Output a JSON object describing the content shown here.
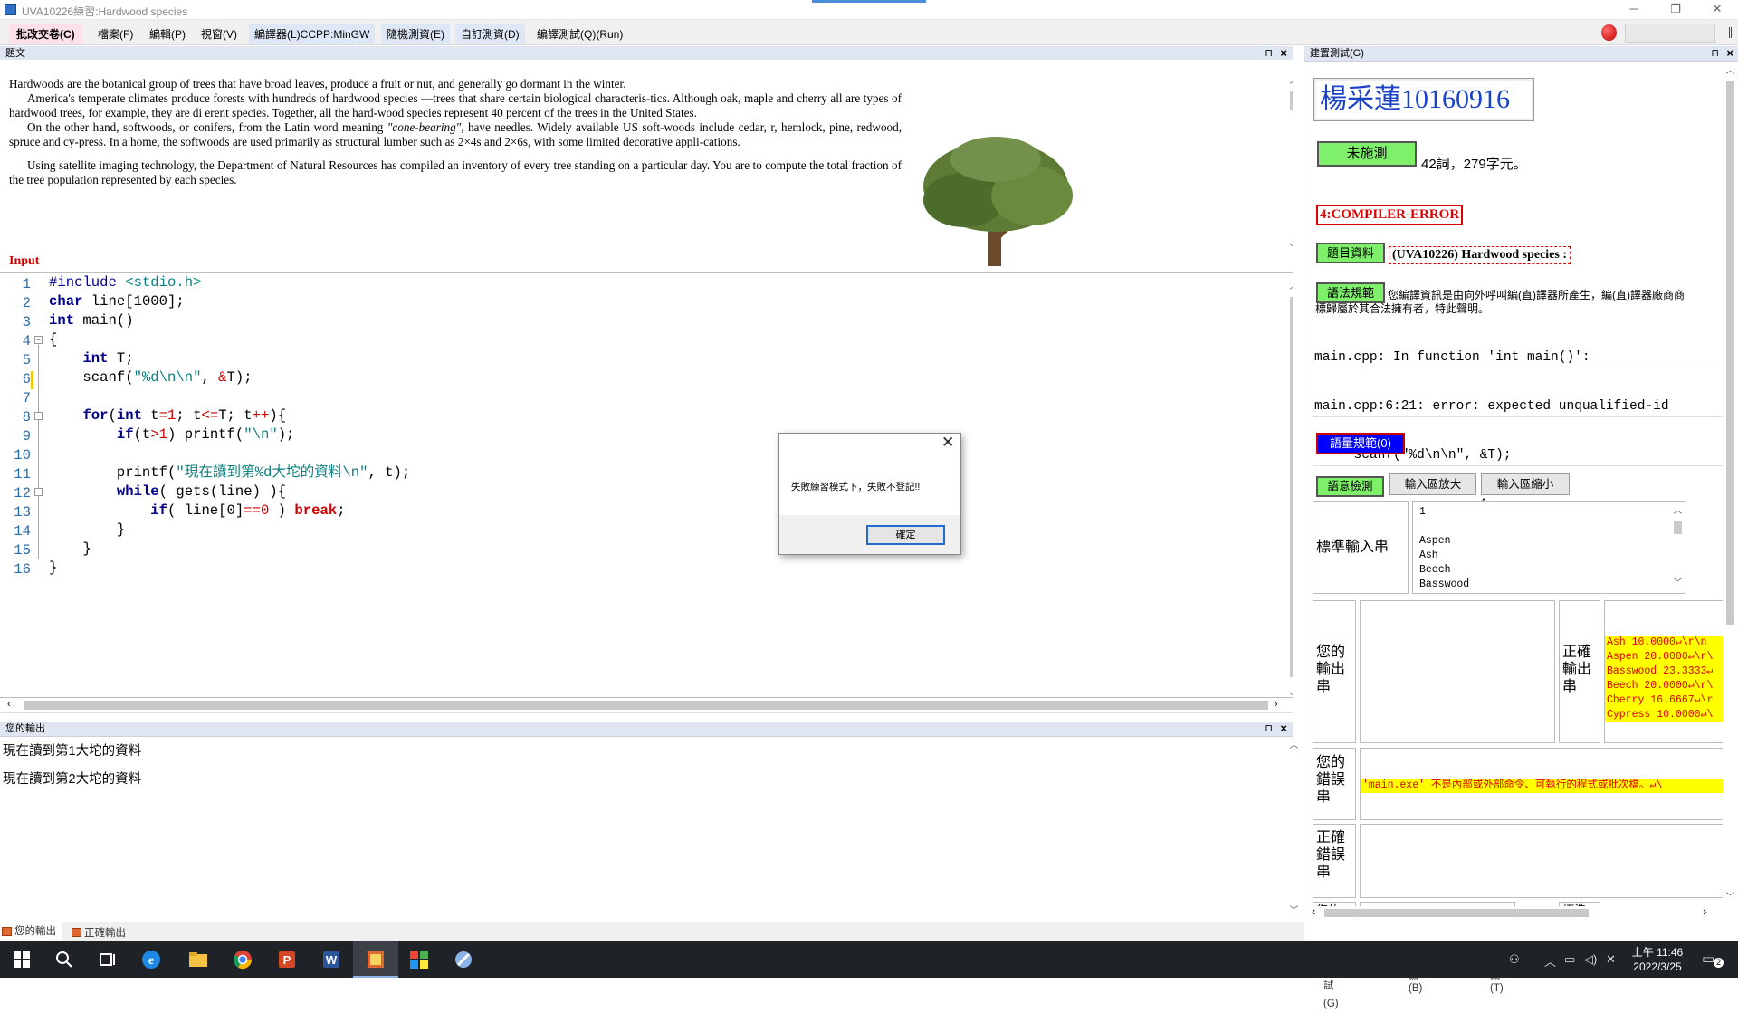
{
  "window": {
    "title": "UVA10226練習:Hardwood species",
    "minimize": "─",
    "restore": "❐",
    "close": "✕"
  },
  "menu": {
    "items": [
      "批改交卷(C)",
      "檔案(F)",
      "編輯(P)",
      "視窗(V)",
      "編譯器(L)CCPP:MinGW",
      "隨機測資(E)",
      "自訂測資(D)",
      "編譯測試(Q)(Run)"
    ]
  },
  "problem_panel": {
    "header": "題文",
    "para1": "Hardwoods are the botanical group of trees that have broad leaves, produce a fruit or nut, and generally go dormant in the winter.",
    "para2": "America's temperate climates produce forests with hundreds of hardwood species —trees that share certain biological characteris-tics. Although oak, maple and cherry all are types of hardwood trees, for example, they are di erent species. Together, all the hard-wood species represent 40 percent of the trees in the United States.",
    "para3_a": "On the other hand, softwoods, or conifers, from the Latin word meaning ",
    "para3_em": "\"cone-bearing\"",
    "para3_b": ", have needles. Widely available US soft-woods include cedar, r, hemlock, pine, redwood, spruce and cy-press. In a home, the softwoods are used primarily as structural lumber such as 2×4s and 2×6s, with some limited decorative appli-cations.",
    "para4": "Using satellite imaging technology, the Department of Natural Resources has compiled an inventory of every tree standing on a particular day. You are to compute the total fraction of the tree population represented by each species.",
    "input_heading": "Input"
  },
  "editor": {
    "line_numbers": [
      "1",
      "2",
      "3",
      "4",
      "5",
      "6",
      "7",
      "8",
      "9",
      "10",
      "11",
      "12",
      "13",
      "14",
      "15",
      "16"
    ]
  },
  "output_panel": {
    "header": "您的輸出",
    "lines": [
      "現在讀到第1大坨的資料",
      "現在讀到第2大坨的資料"
    ]
  },
  "bottom_tabs": {
    "left": [
      "您的輸出",
      "正確輸出"
    ],
    "right": [
      "建置測試(G)",
      "您的小黑(B)",
      "標準小黑(T)"
    ]
  },
  "right_panel": {
    "header": "建置測試(G)",
    "signature": "楊采蓮10160916",
    "status_button": "未施測",
    "stats": "42詞，279字元。",
    "error_label": "4:COMPILER-ERROR",
    "problem_info_button": "題目資料",
    "problem_title": "(UVA10226) Hardwood species :",
    "rules_button": "語法規範",
    "rules_note_1": "您編譯資訊是由向外呼叫編(直)譯器所產生，編(直)譯器廠商商",
    "rules_note_2": "標歸屬於其合法擁有者，特此聲明。",
    "compiler_output": [
      "main.cpp: In function 'int main()':",
      "main.cpp:6:21: error: expected unqualified-id",
      "     scanf(\"%d\\n\\n\", &T);",
      "                     ^"
    ],
    "vocab_button": "語量規範(0)",
    "check_button": "語意檢測",
    "enlarge_input_button": "輸入區放大",
    "shrink_input_button": "輸入區縮小",
    "std_input_label": "標準輸入串",
    "std_input_lines": [
      "1",
      "",
      "Aspen",
      "Ash",
      "Beech",
      "Basswood"
    ],
    "your_output_label": "您的\n輸出\n串",
    "correct_output_label": "正確\n輸出\n串",
    "correct_output_lines": [
      "Ash 10.0000↵\\r\\n",
      "Aspen 20.0000↵\\r\\",
      "Basswood 23.3333↵",
      "Beech 20.0000↵\\r\\",
      "Cherry 16.6667↵\\r",
      "Cypress 10.0000↵\\"
    ],
    "your_error_label": "您的\n錯誤\n串",
    "your_error_text": "'main.exe' 不是內部或外部命令、可執行的程式或批次檔。↵\\",
    "correct_error_label": "正確\n錯誤\n串",
    "partial_label_left": "您的",
    "partial_label_right": "標準"
  },
  "dialog": {
    "message": "失敗練習模式下，失敗不登記!!",
    "ok": "確定",
    "close": "✕"
  },
  "taskbar": {
    "time": "上午 11:46",
    "date": "2022/3/25",
    "notify_count": "2"
  },
  "icons": [
    "windows-start-icon",
    "search-icon",
    "task-view-icon",
    "edge-icon",
    "file-explorer-icon",
    "chrome-icon",
    "powerpoint-icon",
    "word-icon",
    "app-icon",
    "colorful-app-icon",
    "paint-app-icon"
  ]
}
